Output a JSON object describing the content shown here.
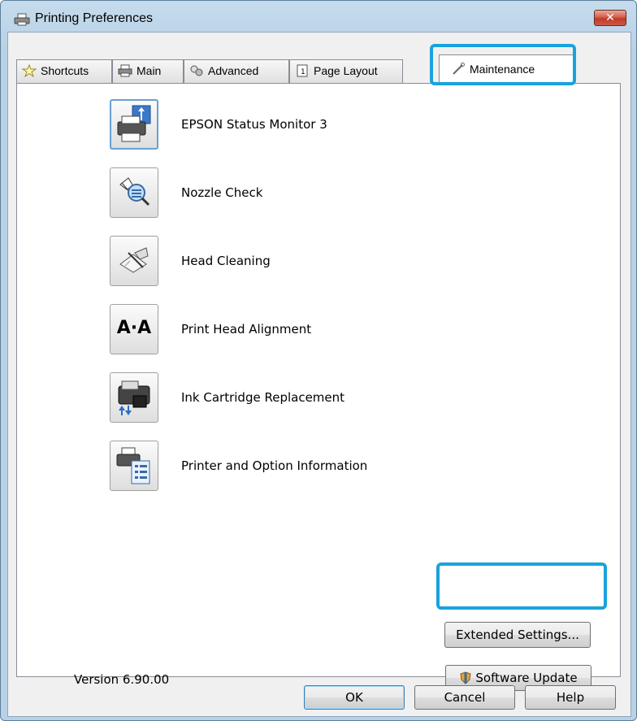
{
  "window": {
    "title": "Printing Preferences",
    "close_label": "✕"
  },
  "tabs": [
    {
      "label": "Shortcuts",
      "icon": "star-icon"
    },
    {
      "label": "Main",
      "icon": "printer-icon"
    },
    {
      "label": "Advanced",
      "icon": "advanced-icon"
    },
    {
      "label": "Page Layout",
      "icon": "page-layout-icon"
    },
    {
      "label": "Maintenance",
      "icon": "wrench-icon",
      "active": true
    }
  ],
  "tools": [
    {
      "label": "EPSON Status Monitor 3",
      "icon": "status-monitor-icon"
    },
    {
      "label": "Nozzle Check",
      "icon": "nozzle-check-icon"
    },
    {
      "label": "Head Cleaning",
      "icon": "head-cleaning-icon"
    },
    {
      "label": "Print Head Alignment",
      "icon": "head-alignment-icon",
      "glyph": "A·A"
    },
    {
      "label": "Ink Cartridge Replacement",
      "icon": "ink-cartridge-icon"
    },
    {
      "label": "Printer and Option Information",
      "icon": "printer-info-icon"
    }
  ],
  "extended_settings_label": "Extended Settings...",
  "software_update_label": "Software Update",
  "version": "Version 6.90.00",
  "footer": {
    "ok": "OK",
    "cancel": "Cancel",
    "help": "Help"
  },
  "colors": {
    "highlight": "#19a3dc",
    "titlebar": "#b8d1e6",
    "close": "#c0392b"
  }
}
